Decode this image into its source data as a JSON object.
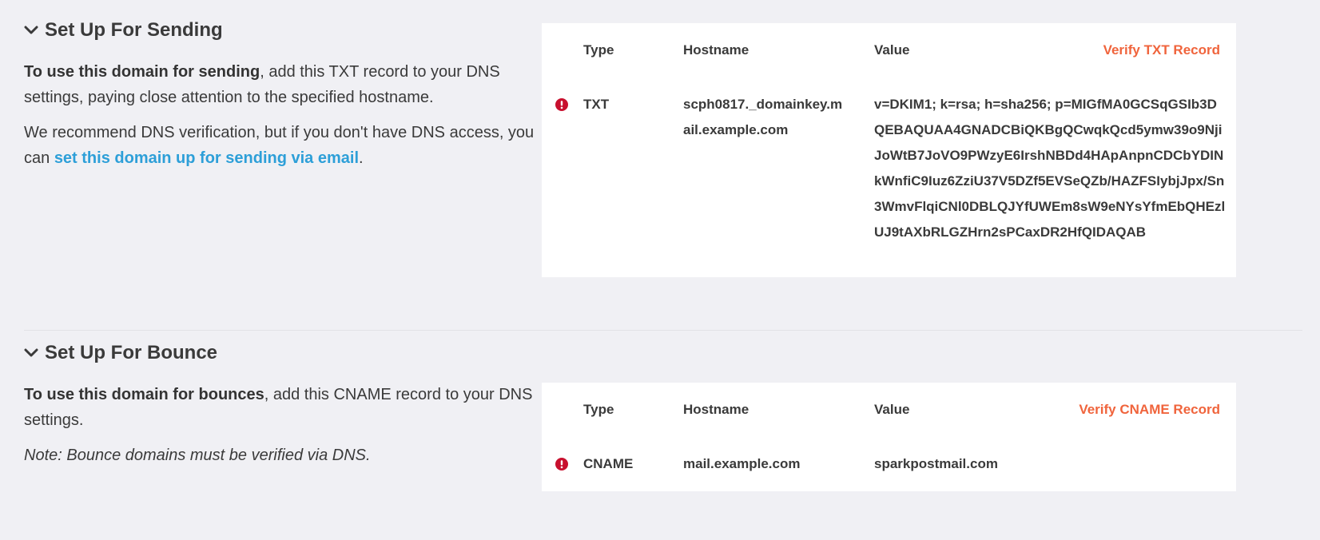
{
  "sending": {
    "heading": "Set Up For Sending",
    "intro_bold": "To use this domain for sending",
    "intro_rest": ", add this TXT record to your DNS settings, paying close attention to the specified hostname.",
    "recommend_text": "We recommend DNS verification, but if you don't have DNS access, you can ",
    "email_link": "set this domain up for sending via email",
    "recommend_end": ".",
    "table": {
      "headers": {
        "type": "Type",
        "hostname": "Hostname",
        "value": "Value"
      },
      "verify_label": "Verify TXT Record",
      "row": {
        "status_icon": "error-icon",
        "type": "TXT",
        "hostname": "scph0817._domainkey.mail.example.com",
        "value": "v=DKIM1; k=rsa; h=sha256; p=MIGfMA0GCSqGSIb3DQEBAQUAA4GNADCBiQKBgQCwqkQcd5ymw39o9NjiJoWtB7JoVO9PWzyE6IrshNBDd4HApAnpnCDCbYDINkWnfiC9Iuz6ZziU37V5DZf5EVSeQZb/HAZFSIybjJpx/Sn3WmvFlqiCNl0DBLQJYfUWEm8sW9eNYsYfmEbQHEzlUJ9tAXbRLGZHrn2sPCaxDR2HfQIDAQAB"
      }
    }
  },
  "bounce": {
    "heading": "Set Up For Bounce",
    "intro_bold": "To use this domain for bounces",
    "intro_rest": ", add this CNAME record to your DNS settings.",
    "note": "Note: Bounce domains must be verified via DNS.",
    "table": {
      "headers": {
        "type": "Type",
        "hostname": "Hostname",
        "value": "Value"
      },
      "verify_label": "Verify CNAME Record",
      "row": {
        "status_icon": "error-icon",
        "type": "CNAME",
        "hostname": "mail.example.com",
        "value": "sparkpostmail.com"
      }
    }
  },
  "colors": {
    "background": "#f0f0f4",
    "card": "#ffffff",
    "text": "#3a3a3a",
    "link": "#2d9fd8",
    "accent": "#f0643c",
    "error": "#c8102e"
  }
}
